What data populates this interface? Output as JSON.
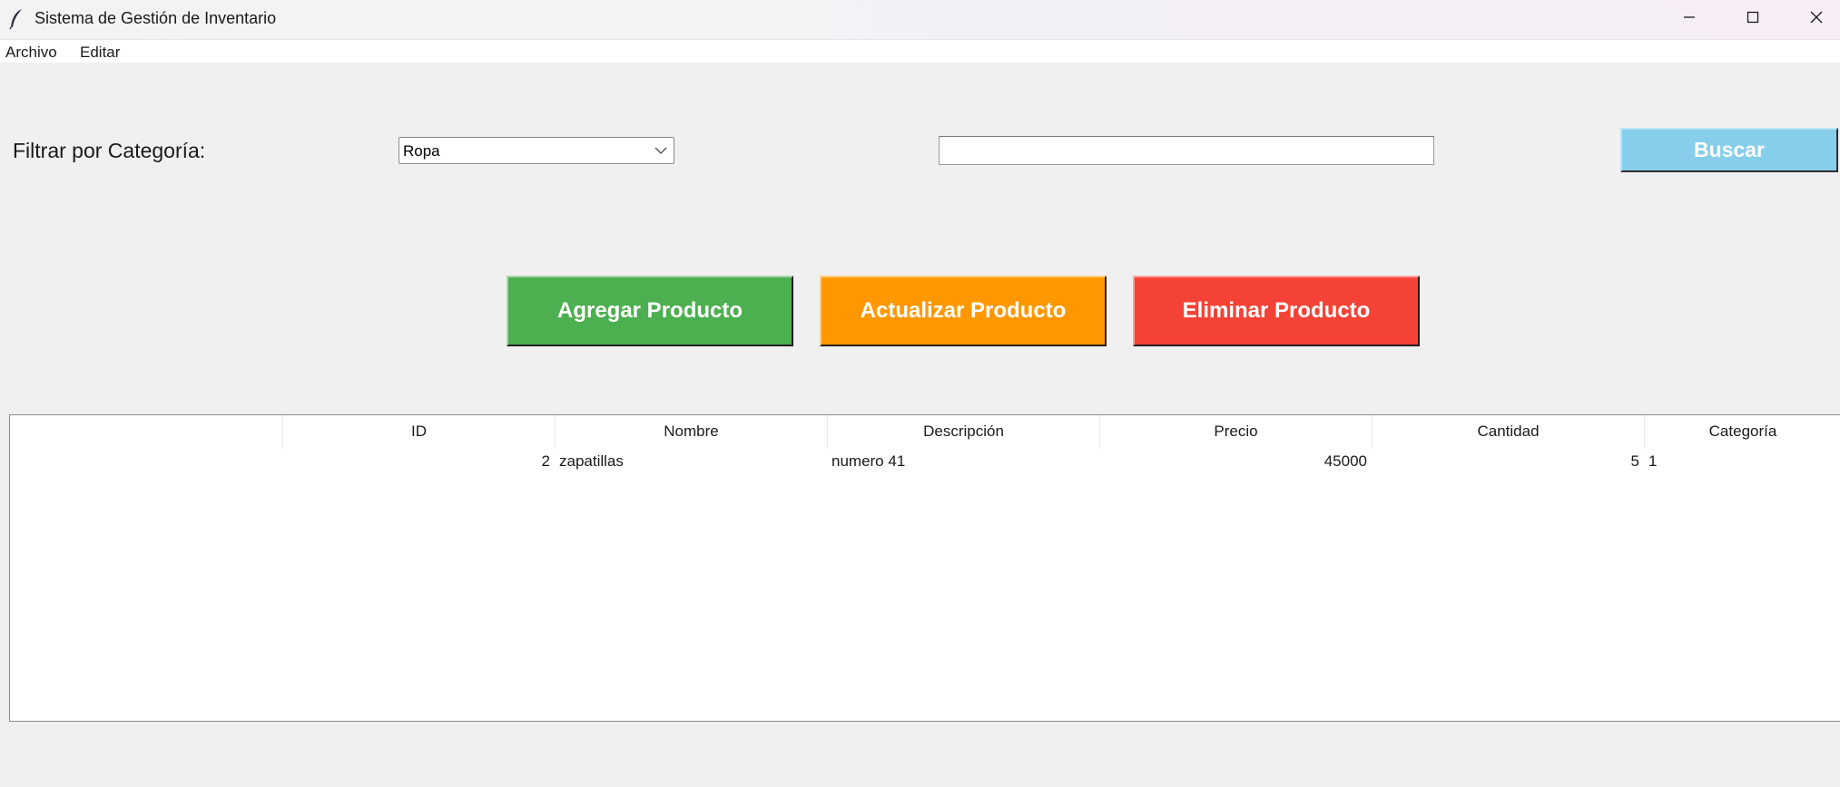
{
  "window": {
    "title": "Sistema de Gestión de Inventario",
    "icon": "feather-icon",
    "controls": [
      "minimize-icon",
      "maximize-icon",
      "close-icon"
    ]
  },
  "menu": {
    "items": [
      "Archivo",
      "Editar"
    ]
  },
  "filter": {
    "label": "Filtrar por Categoría:",
    "category_selected": "Ropa",
    "search_value": "",
    "search_button": "Buscar"
  },
  "actions": {
    "add": "Agregar Producto",
    "update": "Actualizar Producto",
    "delete": "Eliminar Producto"
  },
  "colors": {
    "add": "#4caf50",
    "update": "#ff9800",
    "delete": "#f44336",
    "search": "#87ceeb"
  },
  "table": {
    "columns": [
      "",
      "ID",
      "Nombre",
      "Descripción",
      "Precio",
      "Cantidad",
      "Categoría"
    ],
    "rows": [
      [
        "",
        "2",
        "zapatillas",
        "numero 41",
        "45000",
        "5",
        "1"
      ]
    ]
  }
}
